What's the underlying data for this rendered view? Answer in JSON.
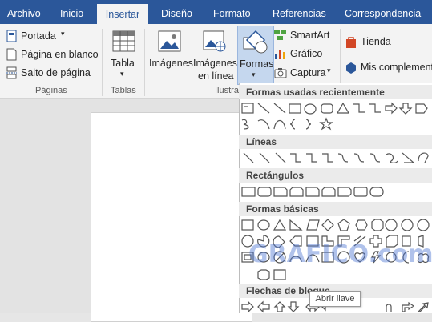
{
  "tabs": [
    {
      "label": "Archivo"
    },
    {
      "label": "Inicio"
    },
    {
      "label": "Insertar"
    },
    {
      "label": "Diseño"
    },
    {
      "label": "Formato"
    },
    {
      "label": "Referencias"
    },
    {
      "label": "Correspondencia"
    }
  ],
  "ribbon": {
    "pages": {
      "portada": "Portada",
      "blank": "Página en blanco",
      "break": "Salto de página",
      "group": "Páginas"
    },
    "tables": {
      "tabla": "Tabla",
      "group": "Tablas"
    },
    "illustrations": {
      "imagenes": "Imágenes",
      "online1": "Imágenes",
      "online2": "en línea",
      "formas": "Formas",
      "smartart": "SmartArt",
      "grafico": "Gráfico",
      "captura": "Captura",
      "group": "Ilustra"
    },
    "addins": {
      "tienda": "Tienda",
      "mis": "Mis complement"
    }
  },
  "gallery": {
    "sections": [
      "Formas usadas recientemente",
      "Líneas",
      "Rectángulos",
      "Formas básicas",
      "Flechas de bloque"
    ]
  },
  "tooltip": "Abrir llave",
  "watermark": "GRAFICO.com",
  "colors": {
    "accent": "#2b579a",
    "ribbon": "#f3f3f3",
    "highlight": "#c5d7ee"
  }
}
